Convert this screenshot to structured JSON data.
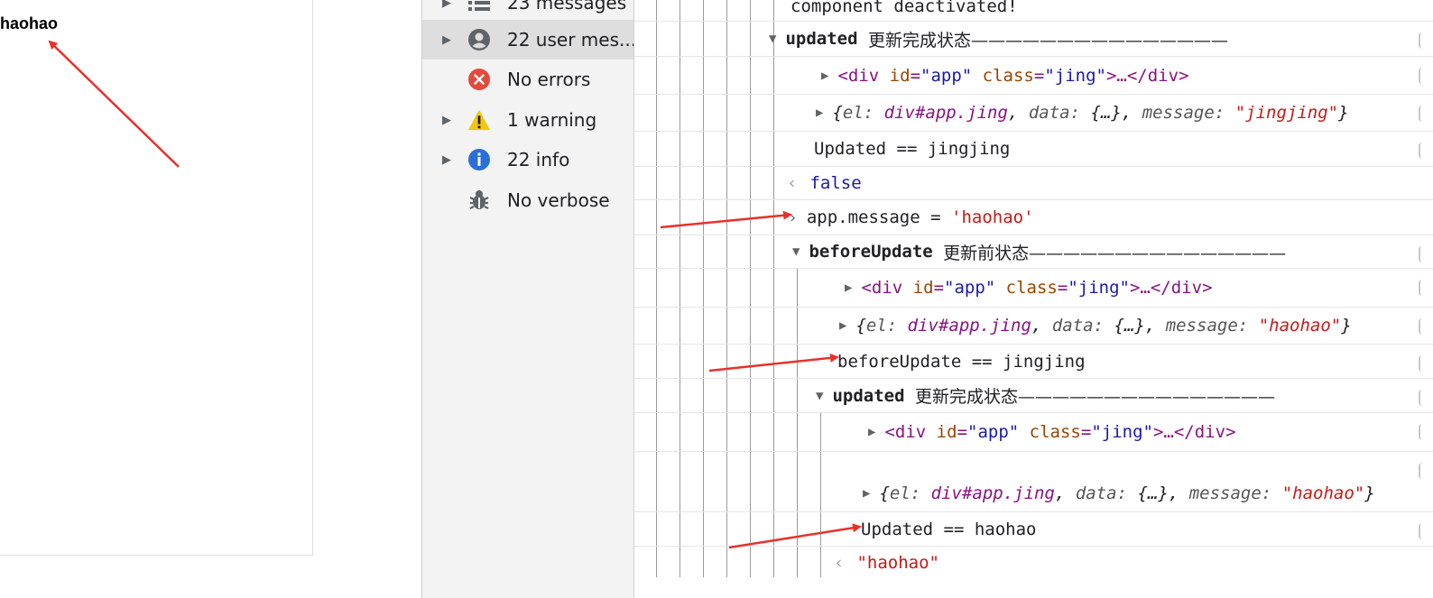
{
  "page": {
    "text": "haohao"
  },
  "sidebar": {
    "items": [
      {
        "label": "23 messages",
        "icon": "list-icon",
        "expandable": true
      },
      {
        "label": "22 user mes...",
        "icon": "user-icon",
        "expandable": true,
        "selected": true
      },
      {
        "label": "No errors",
        "icon": "error-icon",
        "expandable": false
      },
      {
        "label": "1 warning",
        "icon": "warning-icon",
        "expandable": true
      },
      {
        "label": "22 info",
        "icon": "info-icon",
        "expandable": true
      },
      {
        "label": "No verbose",
        "icon": "bug-icon",
        "expandable": false
      }
    ]
  },
  "console": {
    "r0": {
      "text": "component deactivated!"
    },
    "r1": {
      "hook": "updated",
      "label": "更新完成状态———————————————"
    },
    "r2": {
      "lt": "<",
      "tag": "div",
      "a1": "id",
      "v1": "\"app\"",
      "a2": "class",
      "v2": "\"jing\"",
      "mid": ">…</",
      "end": ">"
    },
    "r3": {
      "open": "{",
      "k1": "el:",
      "v1": "div#app.jing",
      "k2": "data:",
      "v2": "{…}",
      "k3": "message:",
      "v3": "\"jingjing\"",
      "close": "}"
    },
    "r4": {
      "text": "Updated == jingjing"
    },
    "r5": {
      "result": "false"
    },
    "r6": {
      "prefix": "app.message",
      "op": "=",
      "value": "'haohao'"
    },
    "r7": {
      "hook": "beforeUpdate",
      "label": "更新前状态———————————————"
    },
    "r8": {
      "lt": "<",
      "tag": "div",
      "a1": "id",
      "v1": "\"app\"",
      "a2": "class",
      "v2": "\"jing\"",
      "mid": ">…</",
      "end": ">"
    },
    "r9": {
      "open": "{",
      "k1": "el:",
      "v1": "div#app.jing",
      "k2": "data:",
      "v2": "{…}",
      "k3": "message:",
      "v3": "\"haohao\"",
      "close": "}"
    },
    "r10": {
      "text": "beforeUpdate == jingjing"
    },
    "r11": {
      "hook": "updated",
      "label": "更新完成状态———————————————"
    },
    "r12": {
      "lt": "<",
      "tag": "div",
      "a1": "id",
      "v1": "\"app\"",
      "a2": "class",
      "v2": "\"jing\"",
      "mid": ">…</",
      "end": ">"
    },
    "r13": {
      "open": "{",
      "k1": "el:",
      "v1": "div#app.jing",
      "k2": "data:",
      "v2": "{…}",
      "k3": "message:",
      "v3": "\"haohao\"",
      "close": "}"
    },
    "r14": {
      "text": "Updated == haohao"
    },
    "r15": {
      "result": "\"haohao\""
    }
  },
  "colors": {
    "arrow": "#e8312a",
    "sidebar_bg": "#f3f3f3",
    "string": "#c41a16",
    "tag": "#881280"
  }
}
